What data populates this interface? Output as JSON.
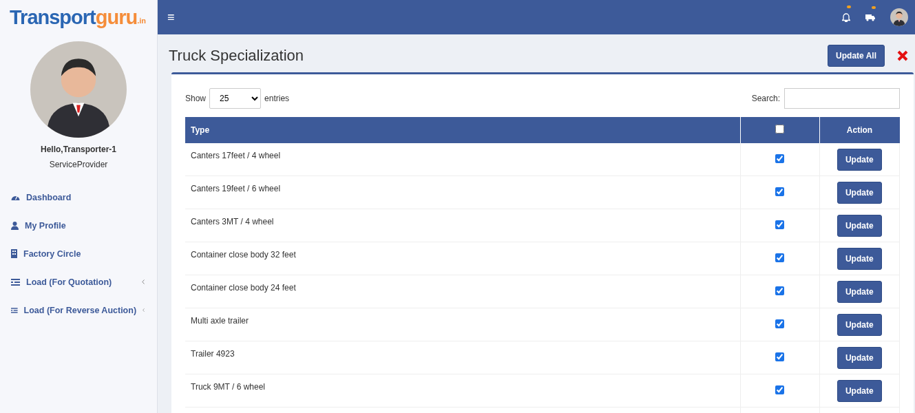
{
  "logo": {
    "part_1": "Transport",
    "part_2": "guru",
    "part_3": ".in"
  },
  "topbar": {
    "menu_glyph": "≡"
  },
  "user": {
    "greeting": "Hello,Transporter-1",
    "role": "ServiceProvider"
  },
  "sidebar": {
    "items": [
      {
        "label": "Dashboard",
        "kind": "gauge",
        "has_caret": false
      },
      {
        "label": "My Profile",
        "kind": "person",
        "has_caret": false
      },
      {
        "label": "Factory Circle",
        "kind": "building",
        "has_caret": false
      },
      {
        "label": "Load (For Quotation)",
        "kind": "list",
        "has_caret": true
      },
      {
        "label": "Load (For Reverse Auction)",
        "kind": "list",
        "has_caret": true
      }
    ]
  },
  "page": {
    "title": "Truck Specialization",
    "update_all": "Update All"
  },
  "table_controls": {
    "show_label": "Show",
    "page_size": "25",
    "entries_label": "entries",
    "search_label": "Search:"
  },
  "table": {
    "columns": [
      "Type",
      "Action"
    ],
    "header_checked": false,
    "rows": [
      {
        "type": "Canters 17feet / 4 wheel",
        "checked": true,
        "action": "Update"
      },
      {
        "type": "Canters 19feet / 6 wheel",
        "checked": true,
        "action": "Update"
      },
      {
        "type": "Canters 3MT / 4 wheel",
        "checked": true,
        "action": "Update"
      },
      {
        "type": "Container close body 32 feet",
        "checked": true,
        "action": "Update"
      },
      {
        "type": "Container close body 24 feet",
        "checked": true,
        "action": "Update"
      },
      {
        "type": "Multi axle trailer",
        "checked": true,
        "action": "Update"
      },
      {
        "type": "Trailer 4923",
        "checked": true,
        "action": "Update"
      },
      {
        "type": "Truck 9MT / 6 wheel",
        "checked": true,
        "action": "Update"
      }
    ]
  }
}
